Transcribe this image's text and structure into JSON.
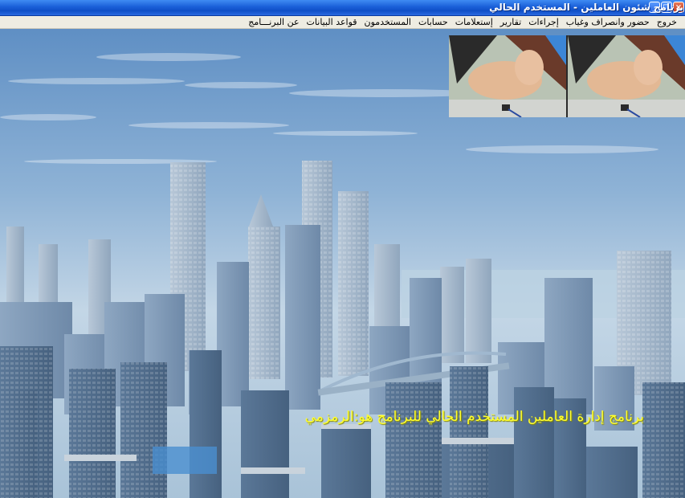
{
  "window": {
    "title": "برنامج شئون العاملين - المستخدم الحالي",
    "buttons": {
      "minimize": "_",
      "maximize": "□",
      "close": "×"
    }
  },
  "menu": {
    "items": [
      "عن البرنـــامج",
      "قواعد البيانات",
      "المستخدمون",
      "حسابات",
      "إستعلامات",
      "تقارير",
      "إجراءات",
      "حضور وانصراف وغياب",
      "خروج"
    ]
  },
  "status": {
    "text": "برنامج إدارة العاملين  المستخدم الحالي للبرنامج هو:الرمزمي"
  },
  "colors": {
    "titlebar": "#1a5fd8",
    "menubar": "#eeece2",
    "status_text": "#ffff2e"
  }
}
